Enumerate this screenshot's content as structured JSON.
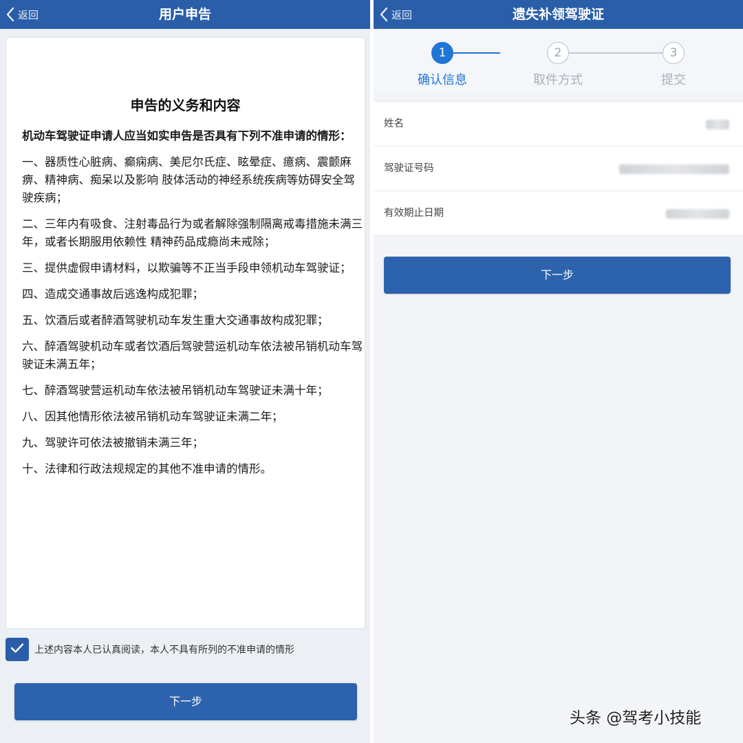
{
  "left": {
    "back_label": "返回",
    "title": "用户申告",
    "card_title": "申告的义务和内容",
    "intro": "机动车驾驶证申请人应当如实申告是否具有下列不准申请的情形：",
    "items": [
      "一、器质性心脏病、癫痫病、美尼尔氏症、眩晕症、癔病、震颤麻痹、精神病、痴呆以及影响 肢体活动的神经系统疾病等妨碍安全驾驶疾病；",
      "二、三年内有吸食、注射毒品行为或者解除强制隔离戒毒措施未满三年，或者长期服用依赖性 精神药品成瘾尚未戒除；",
      "三、提供虚假申请材料，以欺骗等不正当手段申领机动车驾驶证；",
      "四、造成交通事故后逃逸构成犯罪；",
      "五、饮酒后或者醉酒驾驶机动车发生重大交通事故构成犯罪；",
      "六、醉酒驾驶机动车或者饮酒后驾驶营运机动车依法被吊销机动车驾驶证未满五年；",
      "七、醉酒驾驶营运机动车依法被吊销机动车驾驶证未满十年；",
      "八、因其他情形依法被吊销机动车驾驶证未满二年；",
      "九、驾驶许可依法被撤销未满三年；",
      "十、法律和行政法规规定的其他不准申请的情形。"
    ],
    "agree_text": "上述内容本人已认真阅读，本人不具有所列的不准申请的情形",
    "agree_checked": true,
    "next_label": "下一步"
  },
  "right": {
    "back_label": "返回",
    "title": "遗失补领驾驶证",
    "steps": [
      {
        "number": "1",
        "label": "确认信息",
        "state": "active"
      },
      {
        "number": "2",
        "label": "取件方式",
        "state": "inactive"
      },
      {
        "number": "3",
        "label": "提交",
        "state": "inactive"
      }
    ],
    "fields": [
      {
        "label": "姓名"
      },
      {
        "label": "驾驶证号码"
      },
      {
        "label": "有效期止日期"
      }
    ],
    "next_label": "下一步"
  },
  "watermark": "头条 @驾考小技能",
  "colors": {
    "nav_bg": "#2a5ea8",
    "primary_button": "#2d62ad",
    "step_active": "#1f76d6",
    "step_inactive": "#b7c0cc"
  },
  "icons": {
    "back": "chevron-left-icon",
    "checkbox": "check-icon"
  }
}
